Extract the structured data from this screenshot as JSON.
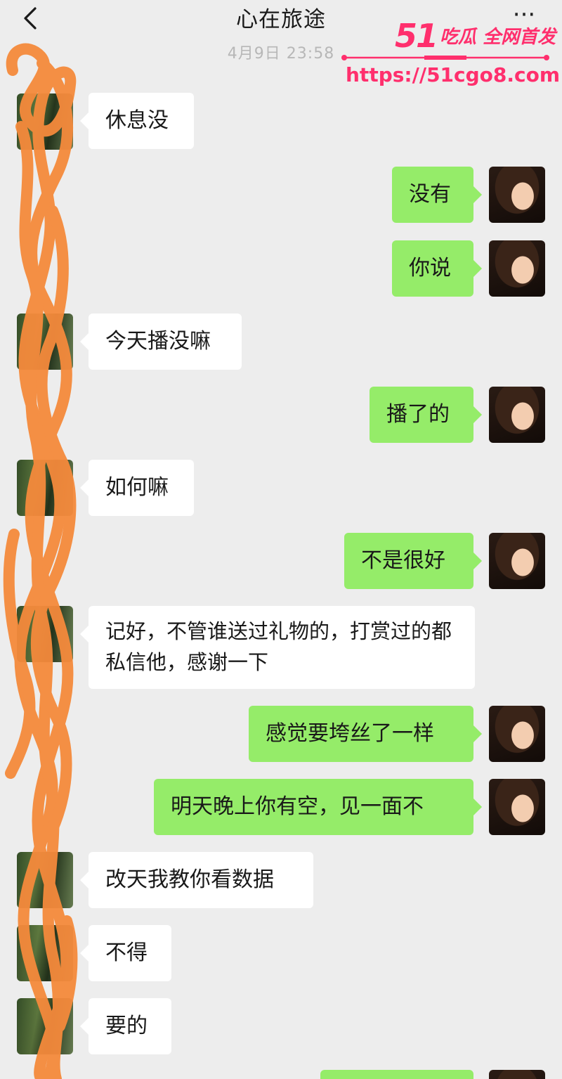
{
  "header": {
    "back_icon": "chevron-left-icon",
    "title": "心在旅途",
    "more_label": "···"
  },
  "timestamp": "4月9日 23:58",
  "watermark": {
    "brand_num": "51",
    "brand_text": "吃瓜 全网首发",
    "url": "https://51cgo8.com",
    "color": "#ff2f6d"
  },
  "colors": {
    "background": "#ededed",
    "incoming_bubble": "#ffffff",
    "outgoing_bubble": "#95ec69",
    "scribble": "#f58a3c"
  },
  "messages": [
    {
      "side": "in",
      "text": "休息没"
    },
    {
      "side": "out",
      "text": "没有"
    },
    {
      "side": "out",
      "text": "你说"
    },
    {
      "side": "in",
      "text": "今天播没嘛"
    },
    {
      "side": "out",
      "text": "播了的"
    },
    {
      "side": "in",
      "text": "如何嘛"
    },
    {
      "side": "out",
      "text": "不是很好"
    },
    {
      "side": "in",
      "text": "记好，不管谁送过礼物的，打赏过的都私信他，感谢一下"
    },
    {
      "side": "out",
      "text": "感觉要垮丝了一样"
    },
    {
      "side": "out",
      "text": "明天晚上你有空，见一面不"
    },
    {
      "side": "in",
      "text": "改天我教你看数据"
    },
    {
      "side": "in",
      "text": "不得"
    },
    {
      "side": "in",
      "text": "要的"
    }
  ]
}
